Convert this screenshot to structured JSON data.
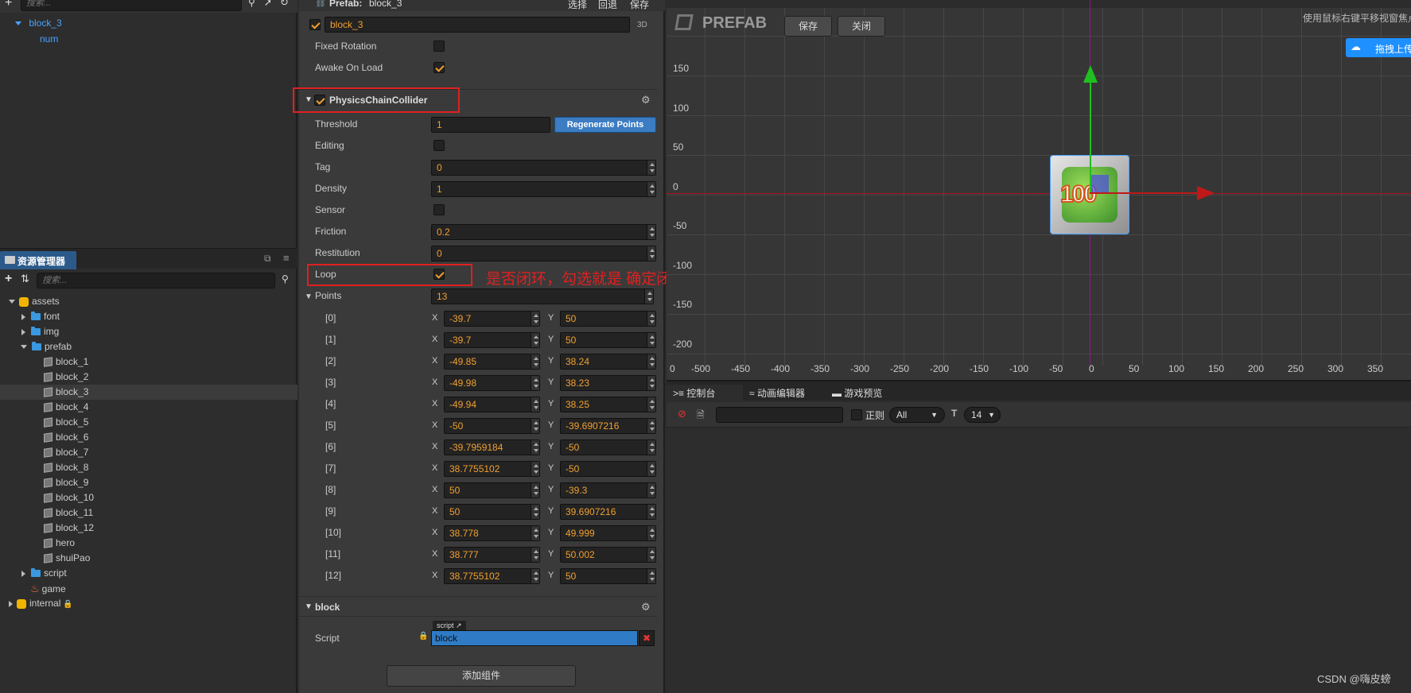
{
  "hierarchy": {
    "search_placeholder": "搜索...",
    "items": [
      {
        "label": "block_3"
      },
      {
        "label": "num"
      }
    ]
  },
  "assets": {
    "title": "资源管理器",
    "search_placeholder": "搜索...",
    "root": "assets",
    "font": "font",
    "img": "img",
    "prefab": "prefab",
    "blocks": [
      "block_1",
      "block_2",
      "block_3",
      "block_4",
      "block_5",
      "block_6",
      "block_7",
      "block_8",
      "block_9",
      "block_10",
      "block_11",
      "block_12"
    ],
    "hero": "hero",
    "shuiPao": "shuiPao",
    "script": "script",
    "game": "game",
    "internal": "internal"
  },
  "inspector": {
    "header_prefix": "Prefab:",
    "header_name": "block_3",
    "header_actions": [
      "选择",
      "回退",
      "保存"
    ],
    "node_name": "block_3",
    "node_mode": "3D",
    "fixed_rotation": "Fixed Rotation",
    "awake_on_load": "Awake On Load",
    "collider_title": "PhysicsChainCollider",
    "threshold_label": "Threshold",
    "threshold_value": "1",
    "regen_button": "Regenerate Points",
    "editing_label": "Editing",
    "tag_label": "Tag",
    "tag_value": "0",
    "density_label": "Density",
    "density_value": "1",
    "sensor_label": "Sensor",
    "friction_label": "Friction",
    "friction_value": "0.2",
    "restitution_label": "Restitution",
    "restitution_value": "0",
    "loop_label": "Loop",
    "loop_annotation": "是否闭环，勾选就是 确定闭环",
    "points_label": "Points",
    "points_count": "13",
    "x_label": "X",
    "y_label": "Y",
    "points": [
      {
        "i": "[0]",
        "x": "-39.7",
        "y": "50"
      },
      {
        "i": "[1]",
        "x": "-39.7",
        "y": "50"
      },
      {
        "i": "[2]",
        "x": "-49.85",
        "y": "38.24"
      },
      {
        "i": "[3]",
        "x": "-49.98",
        "y": "38.23"
      },
      {
        "i": "[4]",
        "x": "-49.94",
        "y": "38.25"
      },
      {
        "i": "[5]",
        "x": "-50",
        "y": "-39.6907216"
      },
      {
        "i": "[6]",
        "x": "-39.7959184",
        "y": "-50"
      },
      {
        "i": "[7]",
        "x": "38.7755102",
        "y": "-50"
      },
      {
        "i": "[8]",
        "x": "50",
        "y": "-39.3"
      },
      {
        "i": "[9]",
        "x": "50",
        "y": "39.6907216"
      },
      {
        "i": "[10]",
        "x": "38.778",
        "y": "49.999"
      },
      {
        "i": "[11]",
        "x": "38.777",
        "y": "50.002"
      },
      {
        "i": "[12]",
        "x": "38.7755102",
        "y": "50"
      }
    ],
    "block_title": "block",
    "script_label": "Script",
    "script_tag": "script",
    "script_value": "block",
    "add_component": "添加组件"
  },
  "scene": {
    "prefab_title": "PREFAB",
    "save_button": "保存",
    "close_button": "关闭",
    "hint": "使用鼠标右键平移视窗焦点",
    "upload_button": "拖拽上传",
    "y_labels": [
      "150",
      "100",
      "50",
      "0",
      "-50",
      "-100",
      "-150",
      "-200"
    ],
    "x_labels": [
      "0",
      "-500",
      "-450",
      "-400",
      "-350",
      "-300",
      "-250",
      "-200",
      "-150",
      "-100",
      "-50",
      "0",
      "50",
      "100",
      "150",
      "200",
      "250",
      "300",
      "350"
    ],
    "sprite_text": "100"
  },
  "console": {
    "tabs": [
      "控制台",
      "动画编辑器",
      "游戏预览"
    ],
    "regex_label": "正则",
    "level_value": "All",
    "font_size": "14"
  },
  "watermark": "CSDN @嗨皮螃"
}
